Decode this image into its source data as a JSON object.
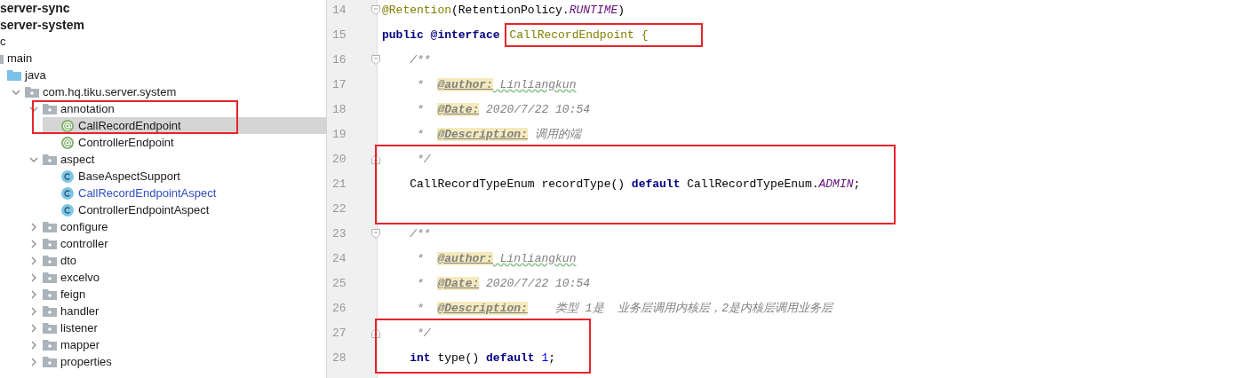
{
  "project_tree": {
    "items": [
      {
        "label": "server-sync",
        "kind": "module",
        "selected": false
      },
      {
        "label": "server-system",
        "kind": "module",
        "selected": false,
        "children": [
          {
            "label": "c",
            "selected": false,
            "children": [
              {
                "label": "main",
                "kind": "folder",
                "selected": false,
                "children": [
                  {
                    "label": "java",
                    "kind": "source-root",
                    "selected": false,
                    "children": [
                      {
                        "label": "com.hq.tiku.server.system",
                        "kind": "package",
                        "expanded": true,
                        "selected": false,
                        "children": [
                          {
                            "label": "annotation",
                            "kind": "package",
                            "expanded": true,
                            "selected": false,
                            "boxed": true,
                            "children": [
                              {
                                "label": "CallRecordEndpoint",
                                "kind": "annotation",
                                "selected": true,
                                "boxed": true
                              },
                              {
                                "label": "ControllerEndpoint",
                                "kind": "annotation",
                                "selected": false
                              }
                            ]
                          },
                          {
                            "label": "aspect",
                            "kind": "package",
                            "expanded": true,
                            "selected": false,
                            "children": [
                              {
                                "label": "BaseAspectSupport",
                                "kind": "class",
                                "selected": false,
                                "modified": false
                              },
                              {
                                "label": "CallRecordEndpointAspect",
                                "kind": "class",
                                "selected": false,
                                "modified": true
                              },
                              {
                                "label": "ControllerEndpointAspect",
                                "kind": "class",
                                "selected": false,
                                "modified": false
                              }
                            ]
                          },
                          {
                            "label": "configure",
                            "kind": "package",
                            "expanded": false,
                            "selected": false
                          },
                          {
                            "label": "controller",
                            "kind": "package",
                            "expanded": false,
                            "selected": false
                          },
                          {
                            "label": "dto",
                            "kind": "package",
                            "expanded": false,
                            "selected": false
                          },
                          {
                            "label": "excelvo",
                            "kind": "package",
                            "expanded": false,
                            "selected": false
                          },
                          {
                            "label": "feign",
                            "kind": "package",
                            "expanded": false,
                            "selected": false
                          },
                          {
                            "label": "handler",
                            "kind": "package",
                            "expanded": false,
                            "selected": false
                          },
                          {
                            "label": "listener",
                            "kind": "package",
                            "expanded": false,
                            "selected": false
                          },
                          {
                            "label": "mapper",
                            "kind": "package",
                            "expanded": false,
                            "selected": false
                          },
                          {
                            "label": "properties",
                            "kind": "package",
                            "expanded": false,
                            "selected": false
                          }
                        ]
                      }
                    ]
                  }
                ]
              }
            ]
          }
        ]
      }
    ]
  },
  "editor": {
    "lines": [
      {
        "number": "14",
        "fold_start": true,
        "fold_end": false,
        "tokens": [
          {
            "t": "@Retention",
            "kind": "annotation"
          },
          {
            "t": "(RetentionPolicy.",
            "kind": "plain"
          },
          {
            "t": "RUNTIME",
            "kind": "constant"
          },
          {
            "t": ")",
            "kind": "plain"
          }
        ]
      },
      {
        "number": "15",
        "fold_start": false,
        "fold_end": false,
        "tokens": [
          {
            "t": "public @interface ",
            "kind": "keyword"
          },
          {
            "t": "CallRecordEndpoint {",
            "kind": "annotation",
            "boxed": true
          }
        ]
      },
      {
        "number": "16",
        "fold_start": true,
        "fold_end": false,
        "tokens": [
          {
            "t": "    /**",
            "kind": "comment"
          }
        ]
      },
      {
        "number": "17",
        "fold_start": false,
        "fold_end": false,
        "tokens": [
          {
            "t": "     *  ",
            "kind": "comment"
          },
          {
            "t": "@author:",
            "kind": "doc-tag"
          },
          {
            "t": " Linliangkun",
            "kind": "typo"
          }
        ]
      },
      {
        "number": "18",
        "fold_start": false,
        "fold_end": false,
        "tokens": [
          {
            "t": "     *  ",
            "kind": "comment"
          },
          {
            "t": "@Date:",
            "kind": "doc-tag"
          },
          {
            "t": " 2020/7/22 10:54",
            "kind": "comment"
          }
        ]
      },
      {
        "number": "19",
        "fold_start": false,
        "fold_end": false,
        "tokens": [
          {
            "t": "     *  ",
            "kind": "comment"
          },
          {
            "t": "@Description:",
            "kind": "doc-tag"
          },
          {
            "t": " 调用的端",
            "kind": "comment"
          }
        ]
      },
      {
        "number": "20",
        "fold_start": false,
        "fold_end": true,
        "boxed": true,
        "tokens": [
          {
            "t": "     */",
            "kind": "comment"
          }
        ]
      },
      {
        "number": "21",
        "fold_start": false,
        "fold_end": false,
        "boxed": true,
        "tokens": [
          {
            "t": "    CallRecordTypeEnum recordType() ",
            "kind": "plain"
          },
          {
            "t": "default",
            "kind": "keyword"
          },
          {
            "t": " CallRecordTypeEnum.",
            "kind": "plain"
          },
          {
            "t": "ADMIN",
            "kind": "constant"
          },
          {
            "t": ";",
            "kind": "plain"
          }
        ]
      },
      {
        "number": "22",
        "fold_start": false,
        "fold_end": false,
        "boxed": true
      },
      {
        "number": "23",
        "fold_start": true,
        "fold_end": false,
        "tokens": [
          {
            "t": "    /**",
            "kind": "comment"
          }
        ]
      },
      {
        "number": "24",
        "fold_start": false,
        "fold_end": false,
        "tokens": [
          {
            "t": "     *  ",
            "kind": "comment"
          },
          {
            "t": "@author:",
            "kind": "doc-tag"
          },
          {
            "t": " Linliangkun",
            "kind": "typo"
          }
        ]
      },
      {
        "number": "25",
        "fold_start": false,
        "fold_end": false,
        "tokens": [
          {
            "t": "     *  ",
            "kind": "comment"
          },
          {
            "t": "@Date:",
            "kind": "doc-tag"
          },
          {
            "t": " 2020/7/22 10:54",
            "kind": "comment"
          }
        ]
      },
      {
        "number": "26",
        "fold_start": false,
        "fold_end": false,
        "tokens": [
          {
            "t": "     *  ",
            "kind": "comment"
          },
          {
            "t": "@Description:",
            "kind": "doc-tag"
          },
          {
            "t": "    类型 1是  业务层调用内核层，2是内核层调用业务层",
            "kind": "comment"
          }
        ]
      },
      {
        "number": "27",
        "fold_start": false,
        "fold_end": true,
        "boxed": true,
        "tokens": [
          {
            "t": "     */",
            "kind": "comment"
          }
        ]
      },
      {
        "number": "28",
        "fold_start": false,
        "fold_end": false,
        "boxed": true,
        "tokens": [
          {
            "t": "    int",
            "kind": "keyword"
          },
          {
            "t": " type() ",
            "kind": "plain"
          },
          {
            "t": "default",
            "kind": "keyword"
          },
          {
            "t": " 1",
            "kind": "number"
          },
          {
            "t": ";",
            "kind": "plain"
          }
        ]
      }
    ]
  }
}
